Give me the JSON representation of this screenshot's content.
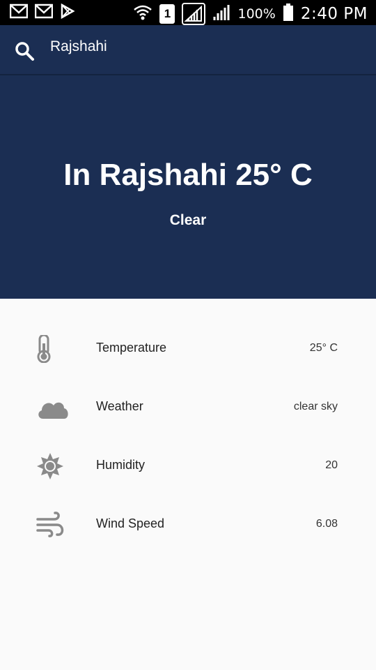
{
  "status_bar": {
    "battery": "100%",
    "time": "2:40 PM",
    "sim_badge": "1"
  },
  "search": {
    "query": "Rajshahi"
  },
  "hero": {
    "title": "In Rajshahi 25° C",
    "condition": "Clear"
  },
  "details": [
    {
      "icon": "thermometer-icon",
      "label": "Temperature",
      "value": "25° C"
    },
    {
      "icon": "cloud-icon",
      "label": "Weather",
      "value": "clear sky"
    },
    {
      "icon": "sun-icon",
      "label": "Humidity",
      "value": "20"
    },
    {
      "icon": "wind-icon",
      "label": "Wind Speed",
      "value": "6.08"
    }
  ],
  "colors": {
    "primary": "#1b2e53",
    "background": "#fafafa",
    "icon_grey": "#8a8a8a"
  }
}
